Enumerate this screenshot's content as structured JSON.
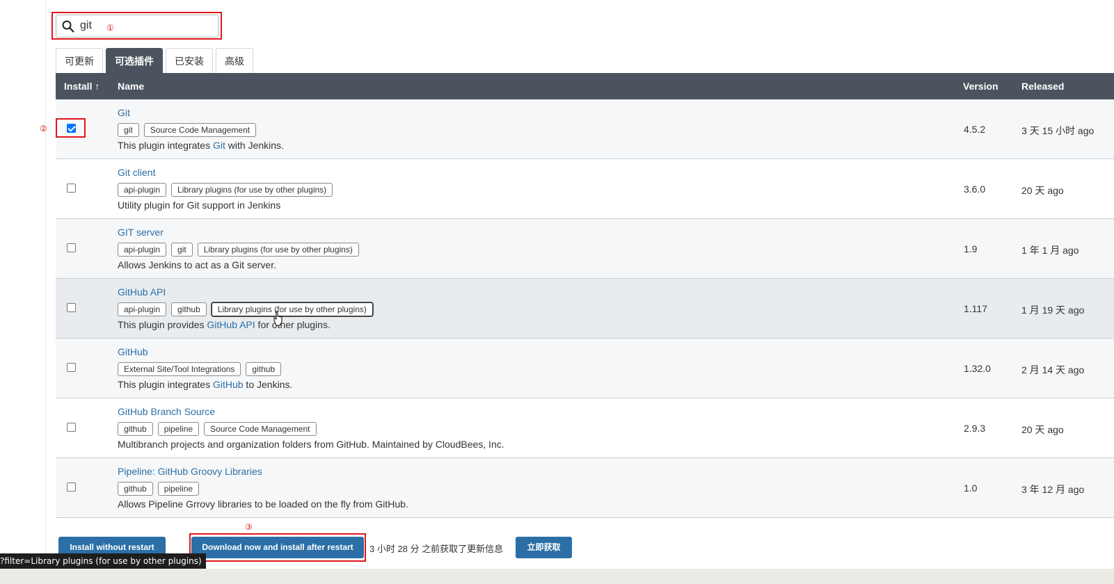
{
  "search": {
    "value": "git",
    "annotation": "①"
  },
  "tabs": [
    {
      "label": "可更新",
      "active": false
    },
    {
      "label": "可选插件",
      "active": true
    },
    {
      "label": "已安装",
      "active": false
    },
    {
      "label": "高级",
      "active": false
    }
  ],
  "table": {
    "headers": {
      "install": "Install ↑",
      "name": "Name",
      "version": "Version",
      "released": "Released"
    },
    "checkbox_annotation": "②",
    "rows": [
      {
        "name": "Git",
        "checked": true,
        "tags": [
          "git",
          "Source Code Management"
        ],
        "desc": [
          "This plugin integrates ",
          "Git",
          " with Jenkins."
        ],
        "version": "4.5.2",
        "released": "3 天 15 小时 ago"
      },
      {
        "name": "Git client",
        "checked": false,
        "tags": [
          "api-plugin",
          "Library plugins (for use by other plugins)"
        ],
        "desc": [
          "Utility plugin for Git support in Jenkins"
        ],
        "version": "3.6.0",
        "released": "20 天 ago"
      },
      {
        "name": "GIT server",
        "checked": false,
        "tags": [
          "api-plugin",
          "git",
          "Library plugins (for use by other plugins)"
        ],
        "desc": [
          "Allows Jenkins to act as a Git server."
        ],
        "version": "1.9",
        "released": "1 年 1 月 ago"
      },
      {
        "name": "GitHub API",
        "checked": false,
        "tags": [
          "api-plugin",
          "github",
          "Library plugins (for use by other plugins)"
        ],
        "desc": [
          "This plugin provides ",
          "GitHub API",
          " for other plugins."
        ],
        "version": "1.117",
        "released": "1 月 19 天 ago"
      },
      {
        "name": "GitHub",
        "checked": false,
        "tags": [
          "External Site/Tool Integrations",
          "github"
        ],
        "desc": [
          "This plugin integrates ",
          "GitHub",
          " to Jenkins."
        ],
        "version": "1.32.0",
        "released": "2 月 14 天 ago"
      },
      {
        "name": "GitHub Branch Source",
        "checked": false,
        "tags": [
          "github",
          "pipeline",
          "Source Code Management"
        ],
        "desc": [
          "Multibranch projects and organization folders from GitHub. Maintained by CloudBees, Inc."
        ],
        "version": "2.9.3",
        "released": "20 天 ago"
      },
      {
        "name": "Pipeline: GitHub Groovy Libraries",
        "checked": false,
        "tags": [
          "github",
          "pipeline"
        ],
        "desc": [
          "Allows Pipeline Grrovy libraries to be loaded on the fly from GitHub."
        ],
        "version": "1.0",
        "released": "3 年 12 月 ago"
      }
    ]
  },
  "actions": {
    "install_without_restart": "Install without restart",
    "download_install_after_restart": "Download now and install after restart",
    "download_annotation": "③",
    "status": "3 小时 28 分 之前获取了更新信息",
    "fetch_now": "立即获取"
  },
  "tooltip": "?filter=Library plugins (for use by other plugins)",
  "colors": {
    "header_bg": "#4b545e",
    "link": "#2b6fa6",
    "annotation": "#e0161b",
    "checkbox_checked": "#0075ff"
  }
}
